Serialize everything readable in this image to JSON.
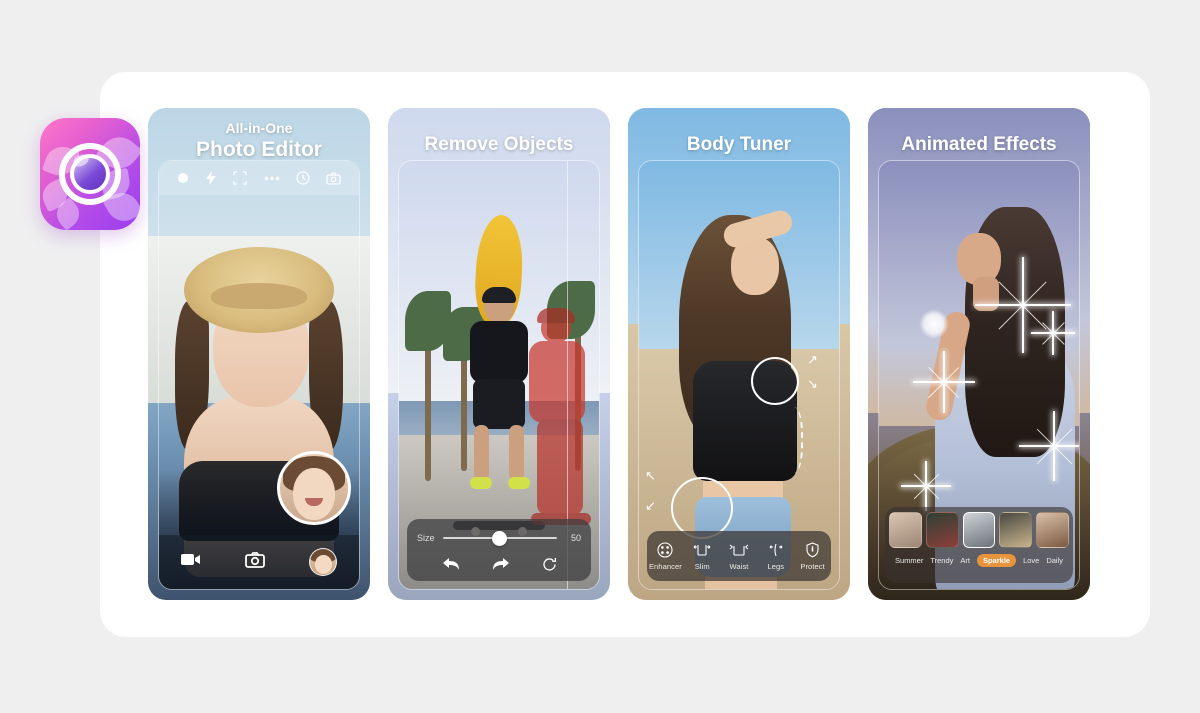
{
  "app": {
    "icon_name": "camera-lens-flower-icon",
    "brand_gradient_start": "#ff77c8",
    "brand_gradient_end": "#9a3df0"
  },
  "page": {
    "background": "#efeff0",
    "card_background": "#ffffff"
  },
  "screens": [
    {
      "id": "photo-editor",
      "title_line1": "All-in-One",
      "title_line2": "Photo Editor",
      "top_toolbar": [
        {
          "name": "shutter-dot-icon",
          "glyph": "dot"
        },
        {
          "name": "flash-icon",
          "glyph": "bolt"
        },
        {
          "name": "face-detect-icon",
          "glyph": "brackets"
        },
        {
          "name": "more-options-icon",
          "glyph": "ellipsis"
        },
        {
          "name": "timer-icon",
          "glyph": "timer"
        },
        {
          "name": "switch-camera-icon",
          "glyph": "camera-flip"
        }
      ],
      "bottom_toolbar": [
        {
          "name": "video-mode-button",
          "glyph": "video"
        },
        {
          "name": "photo-capture-button",
          "glyph": "camera"
        },
        {
          "name": "gallery-avatar-button",
          "glyph": "avatar"
        }
      ]
    },
    {
      "id": "remove-objects",
      "title_line2": "Remove Objects",
      "slider": {
        "label": "Size",
        "value": "50",
        "position_percent": 50
      },
      "actions": [
        {
          "name": "undo-button",
          "glyph": "undo"
        },
        {
          "name": "redo-button",
          "glyph": "redo"
        },
        {
          "name": "reset-button",
          "glyph": "refresh"
        }
      ]
    },
    {
      "id": "body-tuner",
      "title_line2": "Body Tuner",
      "tools": [
        {
          "label": "Enhancer",
          "icon": "enhancer-icon"
        },
        {
          "label": "Slim",
          "icon": "slim-icon"
        },
        {
          "label": "Waist",
          "icon": "waist-icon"
        },
        {
          "label": "Legs",
          "icon": "legs-icon"
        },
        {
          "label": "Protect",
          "icon": "protect-shield-icon"
        }
      ]
    },
    {
      "id": "animated-effects",
      "title_line2": "Animated Effects",
      "filters": [
        {
          "label": "Summer",
          "selected": false
        },
        {
          "label": "Trendy",
          "selected": false
        },
        {
          "label": "Art",
          "selected": false
        },
        {
          "label": "Sparkle",
          "selected": true
        },
        {
          "label": "Love",
          "selected": false
        },
        {
          "label": "Daily",
          "selected": false
        }
      ],
      "selected_thumb_index": 2,
      "active_color": "#e8943c"
    }
  ]
}
